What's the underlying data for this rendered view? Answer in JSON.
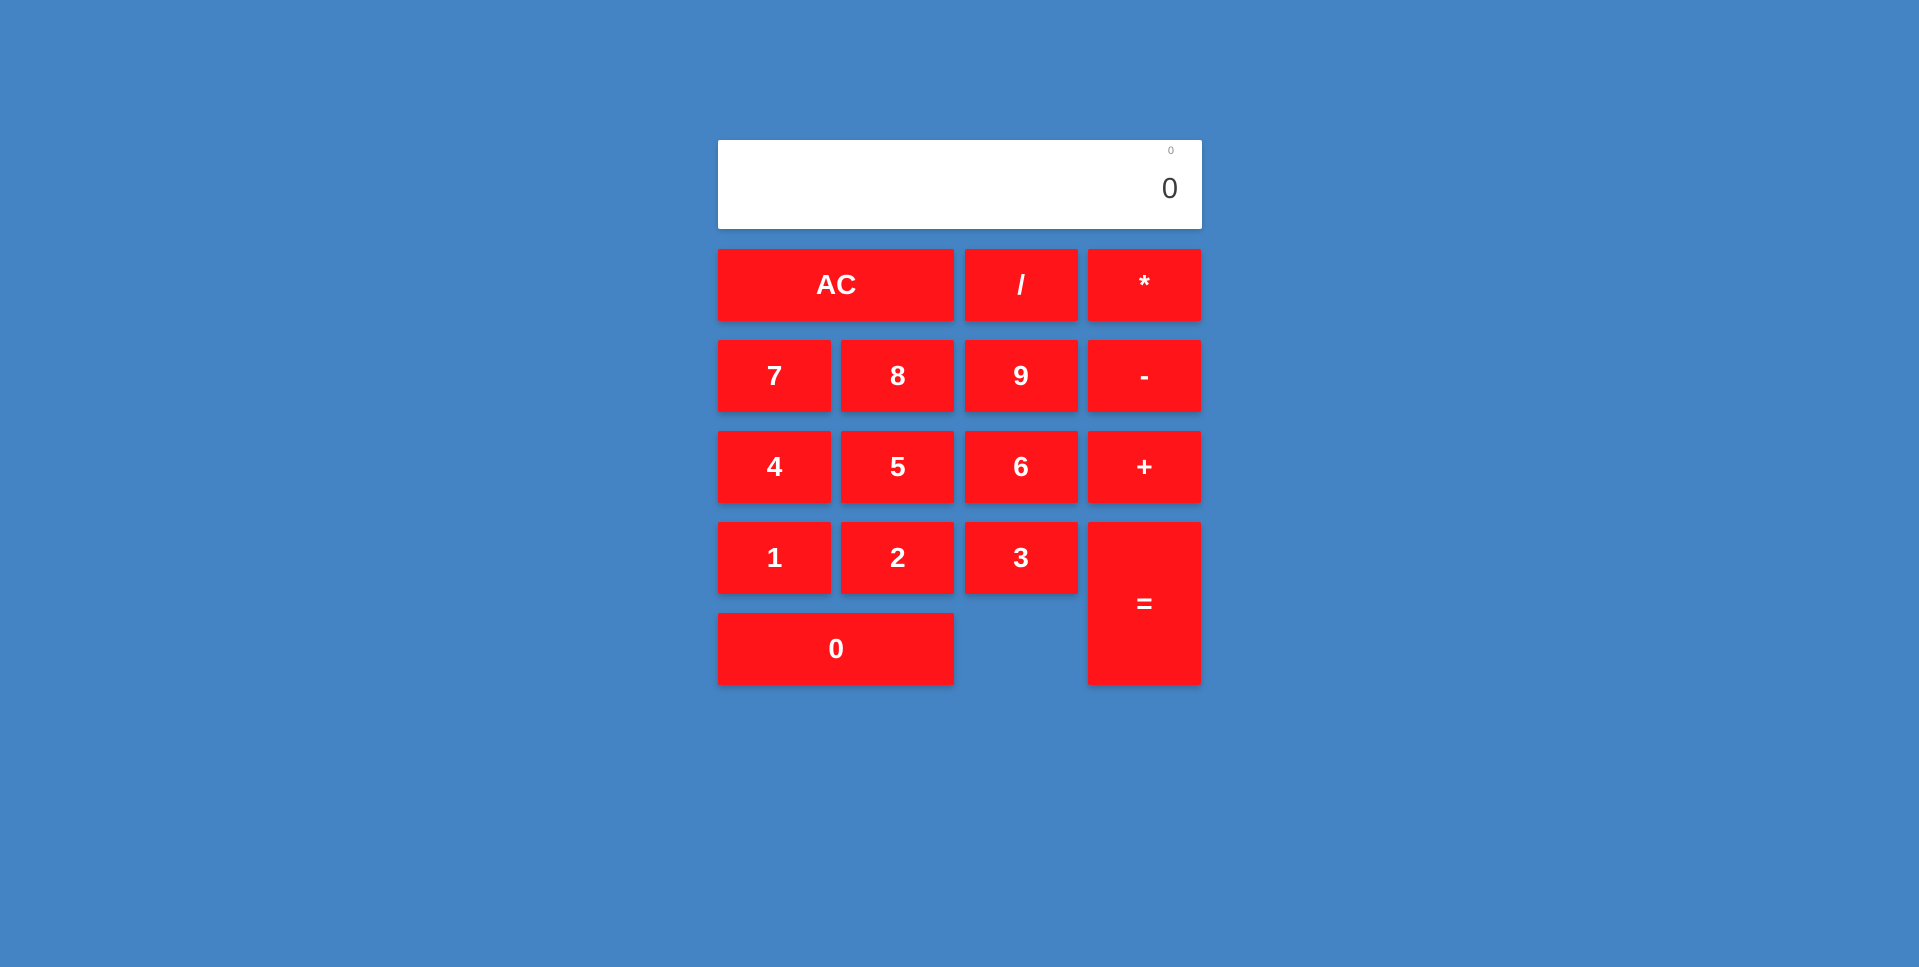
{
  "display": {
    "formula": "0",
    "output": "0"
  },
  "keys": {
    "clear": "AC",
    "divide": "/",
    "multiply": "*",
    "seven": "7",
    "eight": "8",
    "nine": "9",
    "subtract": "-",
    "four": "4",
    "five": "5",
    "six": "6",
    "add": "+",
    "one": "1",
    "two": "2",
    "three": "3",
    "equals": "=",
    "zero": "0"
  },
  "colors": {
    "background": "#4584c4",
    "key": "#ff1419",
    "key_text": "#ffffff",
    "display": "#ffffff"
  }
}
